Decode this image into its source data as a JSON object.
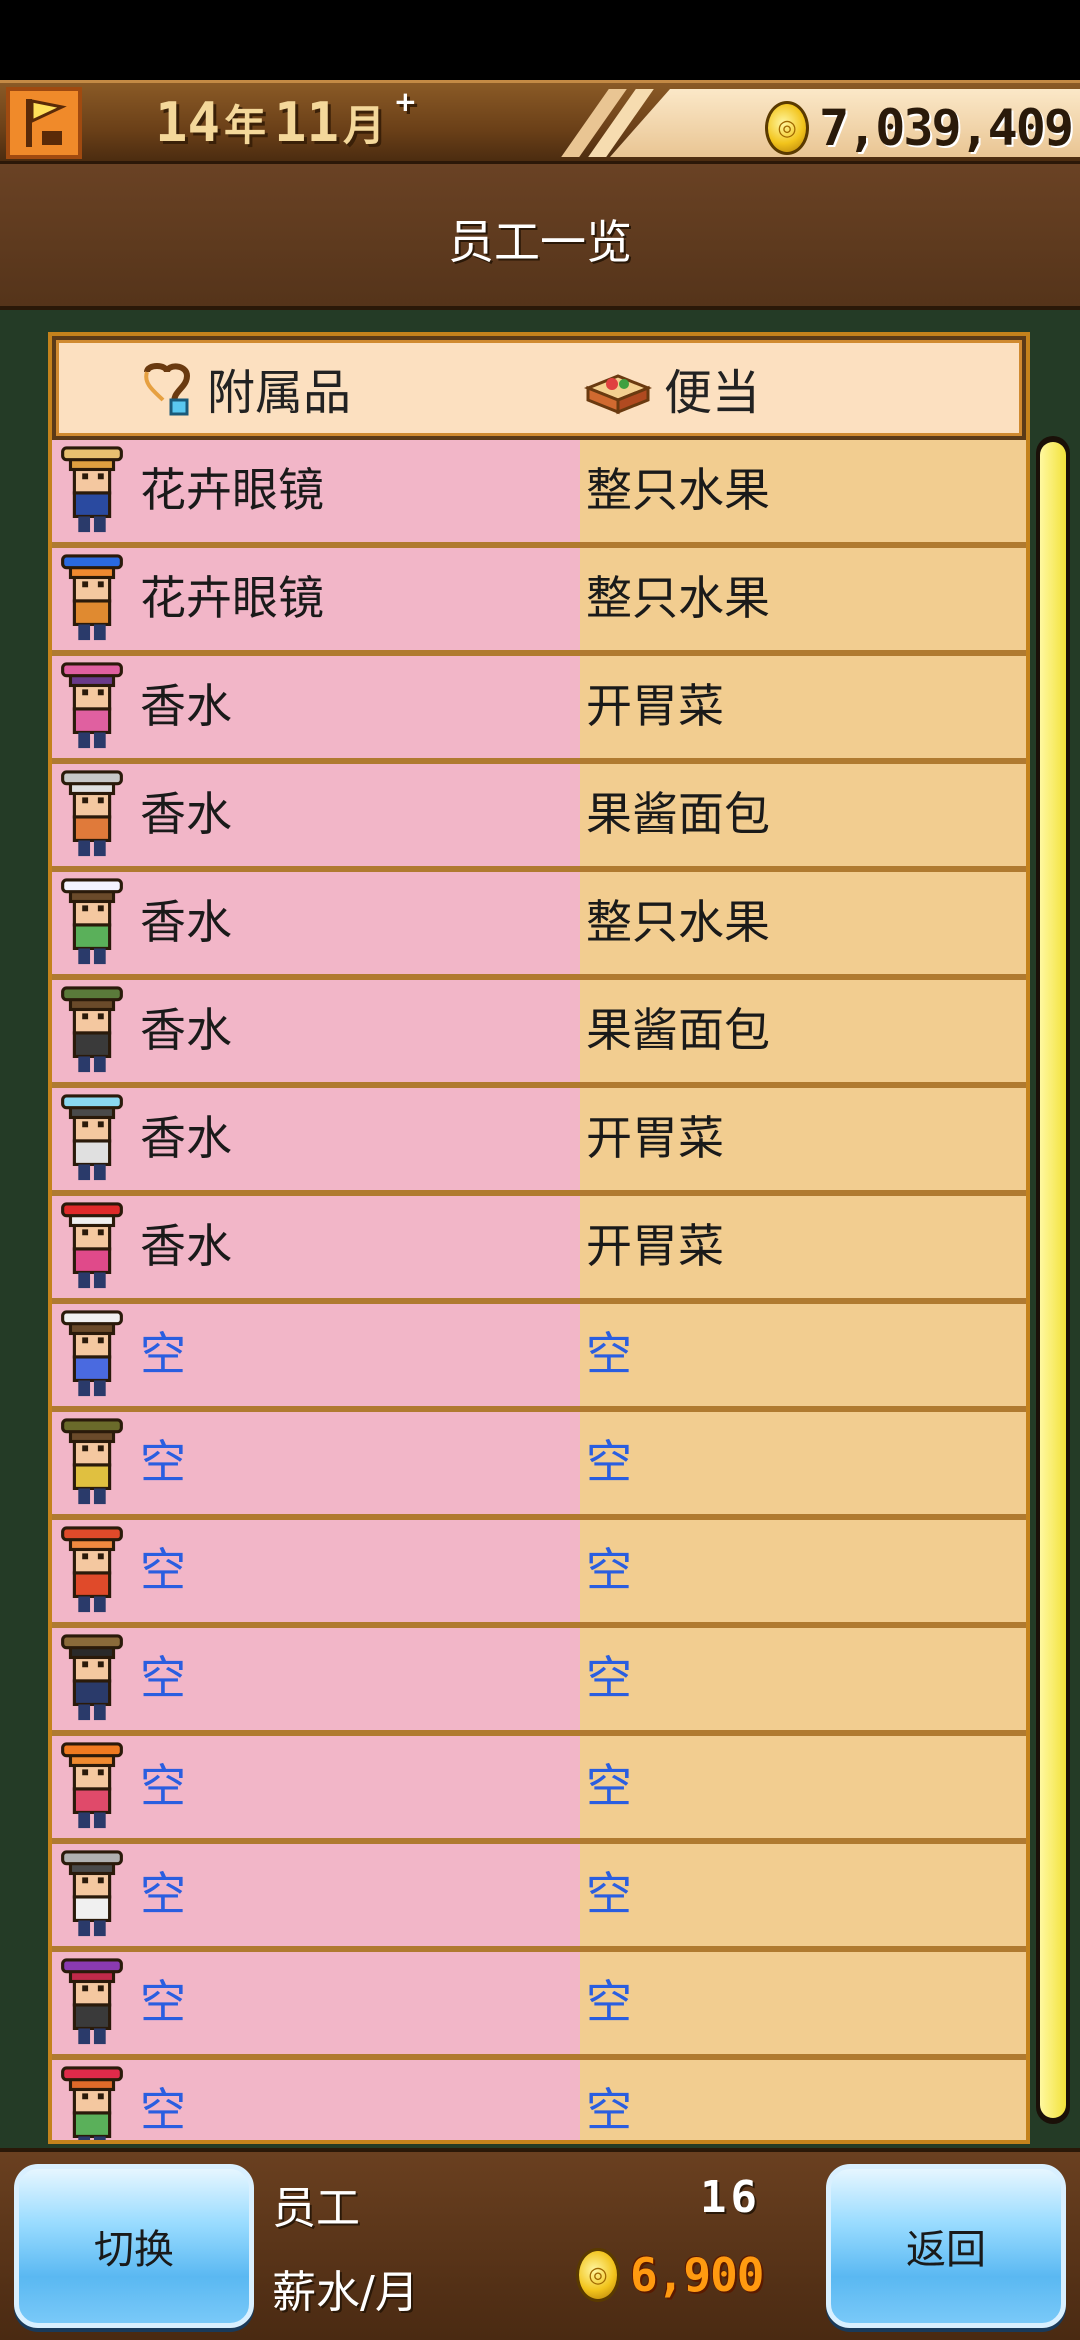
{
  "top_bar": {
    "year_value": "14",
    "year_unit": "年",
    "month_value": "11",
    "month_unit": "月",
    "plus_mark": "+",
    "money": "7,039,409"
  },
  "header": {
    "title": "员工一览"
  },
  "table": {
    "col_accessory": "附属品",
    "col_bento": "便当",
    "rows": [
      {
        "avatar": "straw-hat",
        "accessory": "花卉眼镜",
        "bento": "整只水果"
      },
      {
        "avatar": "blue-bow",
        "accessory": "花卉眼镜",
        "bento": "整只水果"
      },
      {
        "avatar": "pink-bow",
        "accessory": "香水",
        "bento": "开胃菜"
      },
      {
        "avatar": "grey-hair",
        "accessory": "香水",
        "bento": "果酱面包"
      },
      {
        "avatar": "white-hat",
        "accessory": "香水",
        "bento": "整只水果"
      },
      {
        "avatar": "green-cap",
        "accessory": "香水",
        "bento": "果酱面包"
      },
      {
        "avatar": "nightcap",
        "accessory": "香水",
        "bento": "开胃菜"
      },
      {
        "avatar": "santa-hat",
        "accessory": "香水",
        "bento": "开胃菜"
      },
      {
        "avatar": "bunny-ears",
        "accessory": "空",
        "bento": "空"
      },
      {
        "avatar": "olive-cap",
        "accessory": "空",
        "bento": "空"
      },
      {
        "avatar": "red-antlers",
        "accessory": "空",
        "bento": "空"
      },
      {
        "avatar": "top-hat",
        "accessory": "空",
        "bento": "空"
      },
      {
        "avatar": "antennae",
        "accessory": "空",
        "bento": "空"
      },
      {
        "avatar": "goggles",
        "accessory": "空",
        "bento": "空"
      },
      {
        "avatar": "witch-hat",
        "accessory": "空",
        "bento": "空"
      },
      {
        "avatar": "red-bow",
        "accessory": "空",
        "bento": "空"
      }
    ],
    "empty_value": "空",
    "colors": {
      "accessory_bg": "#f2b6c8",
      "bento_bg": "#f2cd90",
      "empty_text": "#2a5ee0"
    }
  },
  "footer": {
    "switch_label": "切换",
    "back_label": "返回",
    "staff_label": "员工",
    "staff_count": "16",
    "salary_label": "薪水/月",
    "salary_value": "6,900"
  }
}
